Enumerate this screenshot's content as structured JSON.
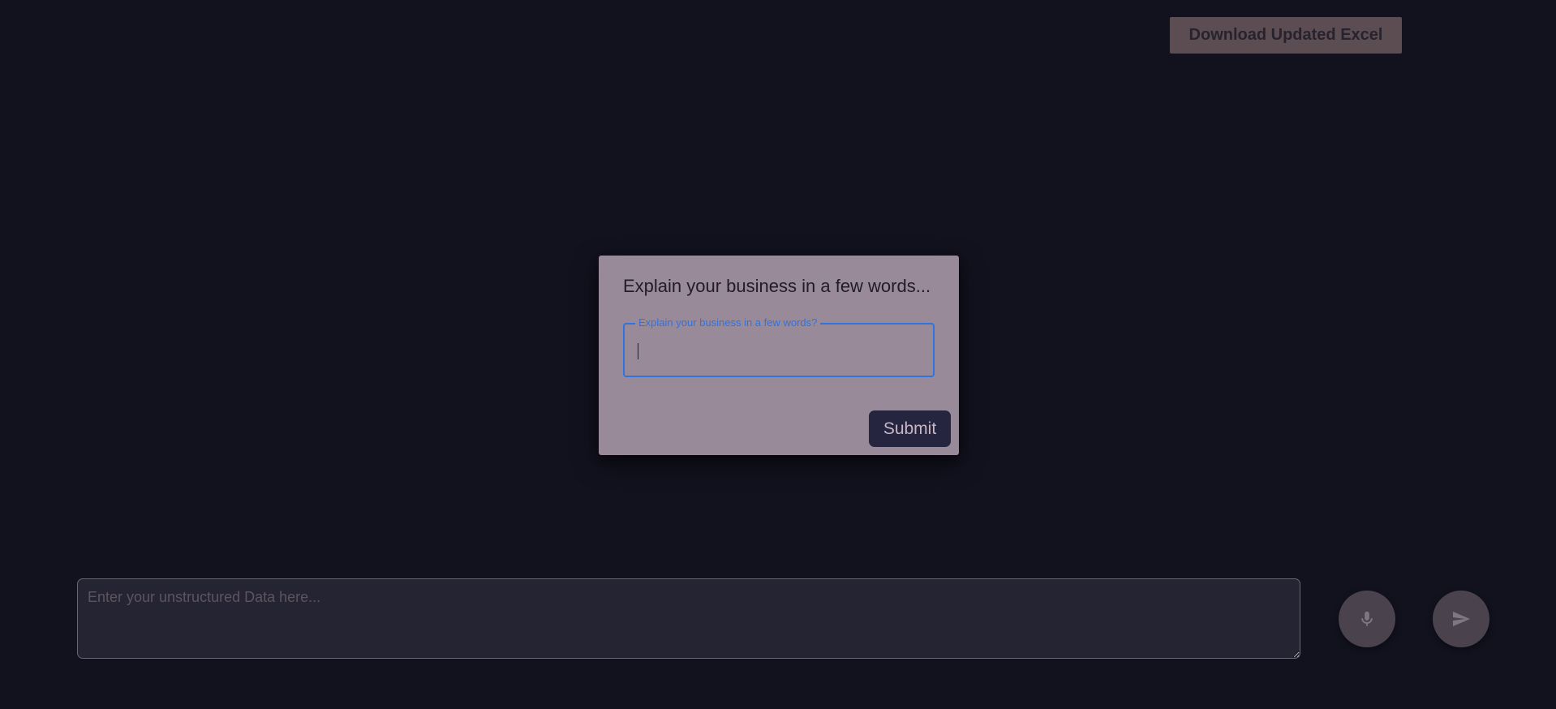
{
  "header": {
    "download_label": "Download Updated Excel"
  },
  "dialog": {
    "title": "Explain your business in a few words...",
    "field_label": "Explain your business in a few words?",
    "field_value": "",
    "submit_label": "Submit"
  },
  "composer": {
    "placeholder": "Enter your unstructured Data here...",
    "value": "",
    "mic_icon": "microphone-icon",
    "send_icon": "send-icon"
  },
  "colors": {
    "background": "#12121f",
    "dialog": "#988a98",
    "accent": "#2f73e0",
    "submit": "#252540"
  }
}
